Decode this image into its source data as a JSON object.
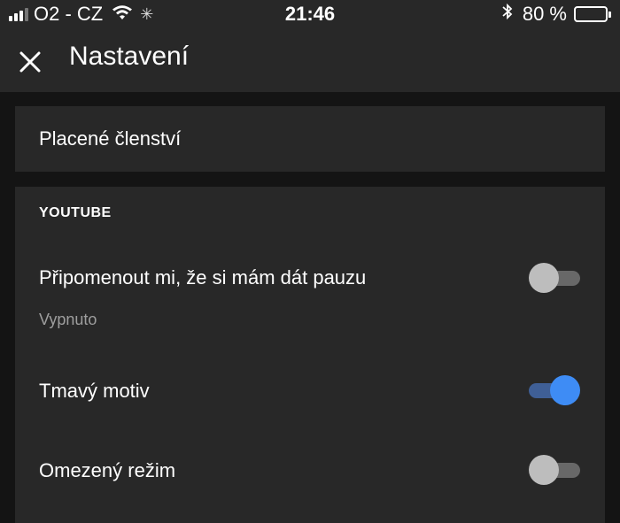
{
  "status_bar": {
    "carrier": "O2 - CZ",
    "time": "21:46",
    "battery_percent": "80 %",
    "battery_level": 0.8,
    "icons": [
      "signal-icon",
      "wifi-icon",
      "loading-icon",
      "bluetooth-icon",
      "battery-icon"
    ]
  },
  "header": {
    "close_icon": "close-icon",
    "title": "Nastavení"
  },
  "membership": {
    "label": "Placené členství"
  },
  "youtube_section": {
    "heading": "YOUTUBE",
    "items": [
      {
        "label": "Připomenout mi, že si mám dát pauzu",
        "sub": "Vypnuto",
        "toggle": false
      },
      {
        "label": "Tmavý motiv",
        "toggle": true
      },
      {
        "label": "Omezený režim",
        "toggle": false
      }
    ]
  },
  "colors": {
    "background": "#141414",
    "surface": "#282828",
    "accent": "#3e8cf5",
    "secondary_text": "#9e9e9e"
  }
}
